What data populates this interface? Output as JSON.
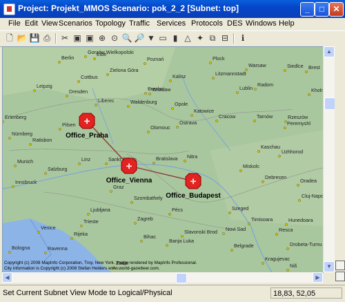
{
  "window": {
    "title": "Project: Projekt_MMOS Scenario: pok_2_2  [Subnet: top]"
  },
  "menu": [
    "File",
    "Edit",
    "View",
    "Scenarios",
    "Topology",
    "Traffic",
    "Services",
    "Protocols",
    "DES",
    "Windows",
    "Help"
  ],
  "toolbar": [
    "new-file",
    "open-folder",
    "save",
    "print",
    "scissors",
    "record",
    "stop",
    "node-editor",
    "locate",
    "zoom-in",
    "zoom-out",
    "drop-down",
    "vna",
    "battery",
    "triangle",
    "marker",
    "copy-window",
    "compare",
    "info"
  ],
  "map": {
    "cities": [
      "Berlin",
      "Gorzów Wielkopolski",
      "Poznań",
      "Plock",
      "Warsaw",
      "Siedlce",
      "Brest",
      "Cottbus",
      "Zielona Góra",
      "Kalisz",
      "Litzmannstadt",
      "Leipzig",
      "Dresden",
      "Liberec",
      "Wroclaw",
      "Breslau",
      "Lublin",
      "Kholm",
      "Radom",
      "Waldenburg",
      "Opole",
      "Katowice",
      "Cracow",
      "Tarnów",
      "Rzeszów",
      "Peremyshl",
      "Pilsen",
      "Olomouc",
      "Ostrava",
      "Kaschau",
      "Uzhhorod",
      "Ratisbon",
      "Linz",
      "Sankt Pölten",
      "Bratislava",
      "Nitra",
      "Miskolc",
      "Munich",
      "Salzburg",
      "Innsbruck",
      "Graz",
      "Szombathely",
      "Debrecen",
      "Oradea",
      "Cluj-Napoca",
      "Szeged",
      "Timisoara",
      "Hunedoara",
      "Pécs",
      "Zagreb",
      "Ljubljana",
      "Trieste",
      "Venice",
      "Bihac",
      "Banja Luka",
      "Slavonski Brod",
      "Novi Sad",
      "Belgrade",
      "Resca",
      "Drobeta-Turnu Severin",
      "Kragujevac",
      "Niš",
      "Zadar",
      "Bologna",
      "Ravenna",
      "Rijeka",
      "Elbe",
      "Nürnberg",
      "Erlenberg"
    ],
    "nodes": [
      {
        "label": "Office_Praha"
      },
      {
        "label": "Office_Vienna"
      },
      {
        "label": "Office_Budapest"
      }
    ],
    "copyright_1": "Copyright (c) 2008 MapInfo Corporation, Troy, New York. Image rendered by MapInfo Professional.",
    "copyright_2": "City information is Copyright (c) 2008 Stefan Helders www.world-gazetteer.com."
  },
  "status": {
    "message": "Set Current Subnet View Mode to Logical/Physical",
    "coords": "18,83, 52,05"
  }
}
